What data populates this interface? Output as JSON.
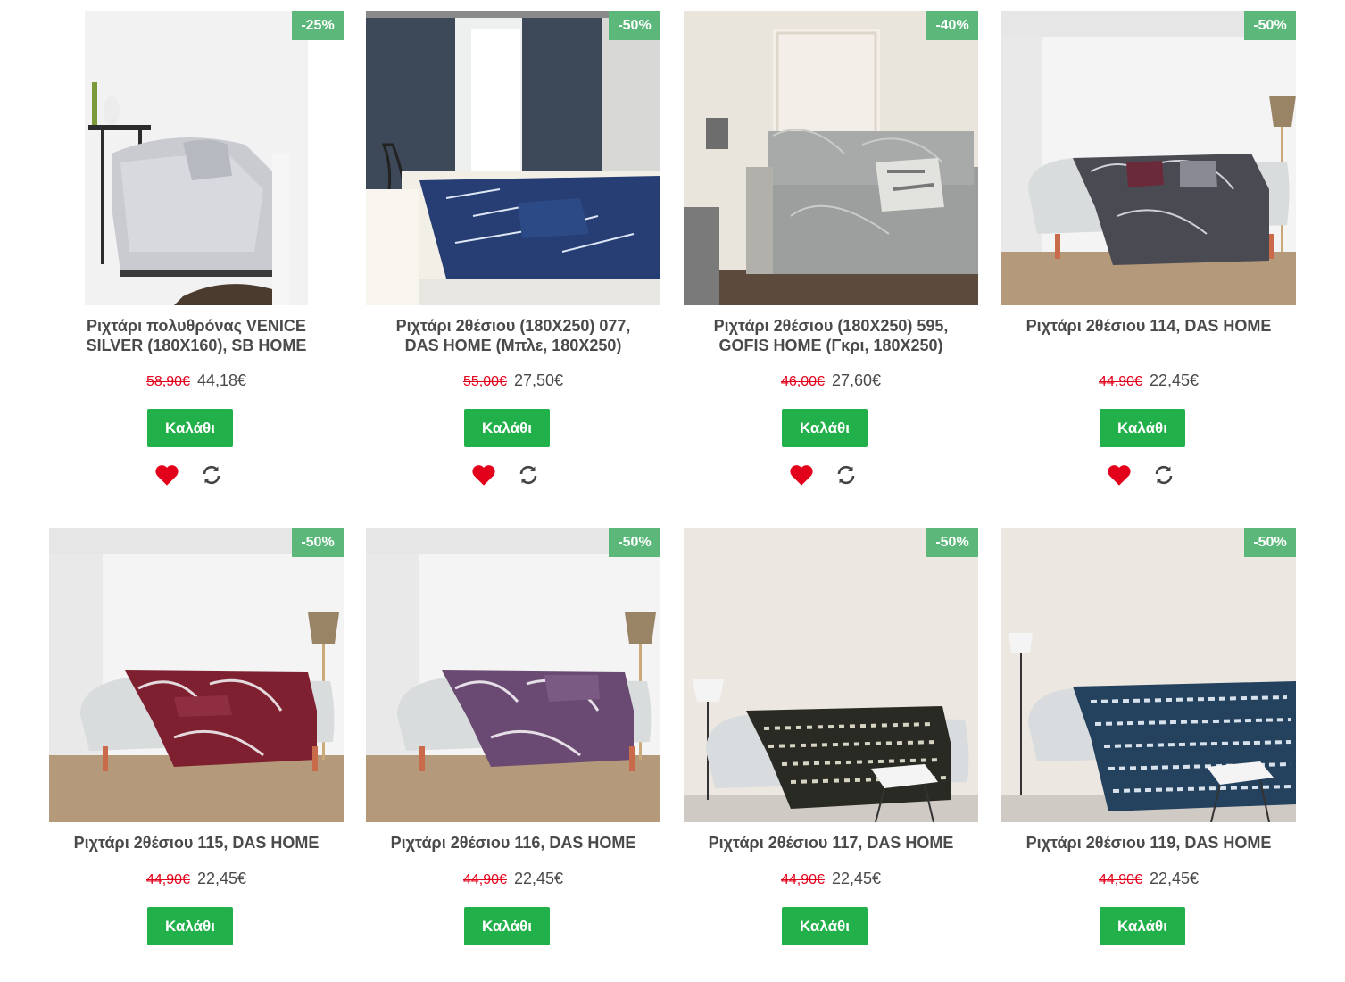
{
  "products": [
    {
      "discount": "-25%",
      "title_line1": "Ριχτάρι πολυθρόνας VENICE",
      "title_line2": "SILVER (180X160), SB HOME",
      "old_price": "58,90€",
      "new_price": "44,18€",
      "cart_label": "Καλάθι",
      "wishlist_icon": "heart-icon",
      "compare_icon": "refresh-icon",
      "image": "armchair-grey-throw"
    },
    {
      "discount": "-50%",
      "title_line1": "Ριχτάρι 2θέσιου (180X250) 077,",
      "title_line2": "DAS HOME (Μπλε, 180X250)",
      "old_price": "55,00€",
      "new_price": "27,50€",
      "cart_label": "Καλάθι",
      "wishlist_icon": "heart-icon",
      "compare_icon": "refresh-icon",
      "image": "sofa-blue-throw-curtains"
    },
    {
      "discount": "-40%",
      "title_line1": "Ριχτάρι 2θέσιου (180X250) 595,",
      "title_line2": "GOFIS HOME (Γκρι, 180X250)",
      "old_price": "46,00€",
      "new_price": "27,60€",
      "cart_label": "Καλάθι",
      "wishlist_icon": "heart-icon",
      "compare_icon": "refresh-icon",
      "image": "sofa-grey-throw"
    },
    {
      "discount": "-50%",
      "title_line1": "Ριχτάρι 2θέσιου 114, DAS HOME",
      "title_line2": "",
      "old_price": "44,90€",
      "new_price": "22,45€",
      "cart_label": "Καλάθι",
      "wishlist_icon": "heart-icon",
      "compare_icon": "refresh-icon",
      "image": "sofa-black-white-throw"
    },
    {
      "discount": "-50%",
      "title_line1": "Ριχτάρι 2θέσιου 115, DAS HOME",
      "title_line2": "",
      "old_price": "44,90€",
      "new_price": "22,45€",
      "cart_label": "Καλάθι",
      "image": "sofa-red-throw"
    },
    {
      "discount": "-50%",
      "title_line1": "Ριχτάρι 2θέσιου 116, DAS HOME",
      "title_line2": "",
      "old_price": "44,90€",
      "new_price": "22,45€",
      "cart_label": "Καλάθι",
      "image": "sofa-purple-throw"
    },
    {
      "discount": "-50%",
      "title_line1": "Ριχτάρι 2θέσιου 117, DAS HOME",
      "title_line2": "",
      "old_price": "44,90€",
      "new_price": "22,45€",
      "cart_label": "Καλάθι",
      "image": "sofa-black-pattern-throw"
    },
    {
      "discount": "-50%",
      "title_line1": "Ριχτάρι 2θέσιου 119, DAS HOME",
      "title_line2": "",
      "old_price": "44,90€",
      "new_price": "22,45€",
      "cart_label": "Καλάθι",
      "image": "sofa-blue-pattern-throw"
    }
  ],
  "colors": {
    "badge": "#5cb87a",
    "cart": "#22b04b",
    "old_price": "#e2001a",
    "heart": "#e2001a",
    "text": "#4a4a4a"
  }
}
